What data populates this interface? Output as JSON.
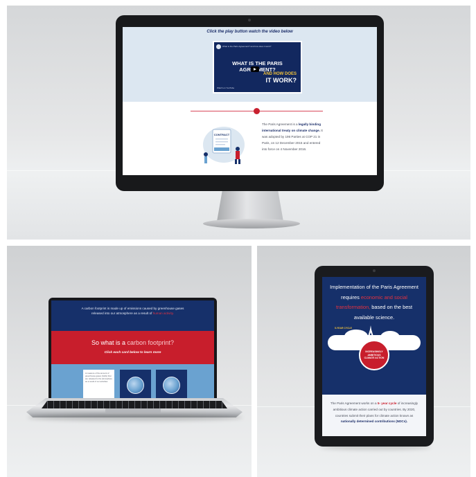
{
  "desktop": {
    "video_instruction": "Click the play button watch the video below",
    "video": {
      "topbar_text": "What is the Paris Agreement? and how does it work?",
      "title": "WHAT IS THE PARIS AGREEMENT?",
      "subtitle_1": "AND HOW DOES",
      "subtitle_2": "IT WORK?",
      "youtube_label": "Watch on YouTube"
    },
    "paris_text": {
      "part1": "The Paris Agreement is a ",
      "bold": "legally binding international treaty on climate change.",
      "part2": " It was adopted by 196 Parties at COP 21 in Paris, on 12 December 2015 and entered into force on 4 November 2016."
    },
    "illustration_label": "CONTRACT"
  },
  "laptop": {
    "intro": "A carbon footprint is made up of emissions caused by greenhouse gases released into our atmosphere as a result of",
    "intro_red": "human activity.",
    "heading": "So what is a",
    "heading_red": "carbon footprint?",
    "subheading": "Click each card below to learn more",
    "card_text": "A measure of the amount of greenhouse gases (GHG) that are released to the atmosphere as a result of our activities"
  },
  "tablet": {
    "heading_1": "Implementation of the Paris Agreement requires",
    "heading_red": "economic and social transformation,",
    "heading_2": "based on the best available science.",
    "cycle_label": "5-YEAR CYCLE",
    "badge_text": "INCREASINGLY AMBITIOUS CLIMATE ACTION",
    "body_1": "The Paris Agreement works on a ",
    "body_red": "5- year cycle",
    "body_2": " of increasingly ambitious climate action carried out by countries. By 2020, countries submit their plans for climate action known as ",
    "body_bold": "nationally determined contributions (NDCs)."
  },
  "colors": {
    "navy": "#16306a",
    "red": "#c81e2c",
    "light_blue": "#6aa2d0",
    "pale_blue": "#dce7f1"
  }
}
